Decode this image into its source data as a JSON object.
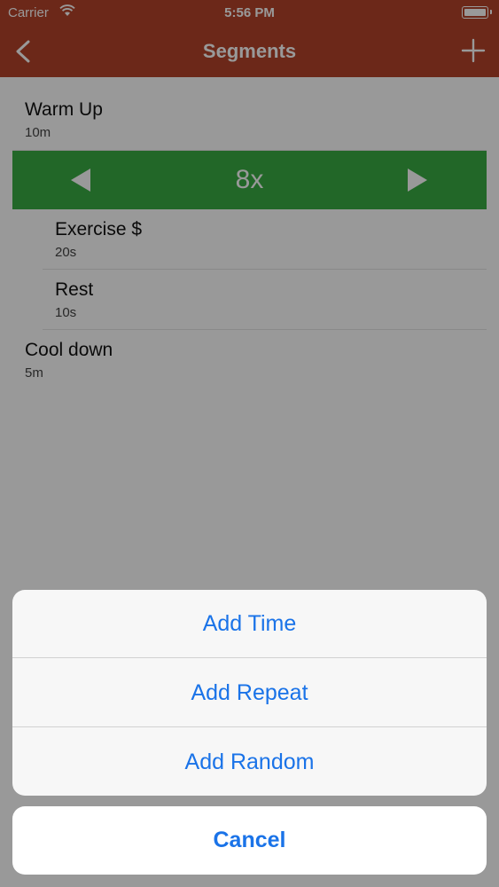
{
  "status_bar": {
    "carrier": "Carrier",
    "time": "5:56 PM"
  },
  "nav": {
    "title": "Segments",
    "back_icon": "chevron-left-icon",
    "add_icon": "plus-icon"
  },
  "segments": {
    "warm_up": {
      "name": "Warm Up",
      "duration": "10m"
    },
    "repeat": {
      "count": "8x"
    },
    "exercise": {
      "name": "Exercise $",
      "duration": "20s"
    },
    "rest": {
      "name": "Rest",
      "duration": "10s"
    },
    "cool_down": {
      "name": "Cool down",
      "duration": "5m"
    }
  },
  "action_sheet": {
    "items": [
      "Add Time",
      "Add Repeat",
      "Add Random"
    ],
    "cancel": "Cancel"
  },
  "colors": {
    "nav": "#b5442a",
    "repeat": "#3aac44",
    "action": "#1a73e8"
  }
}
